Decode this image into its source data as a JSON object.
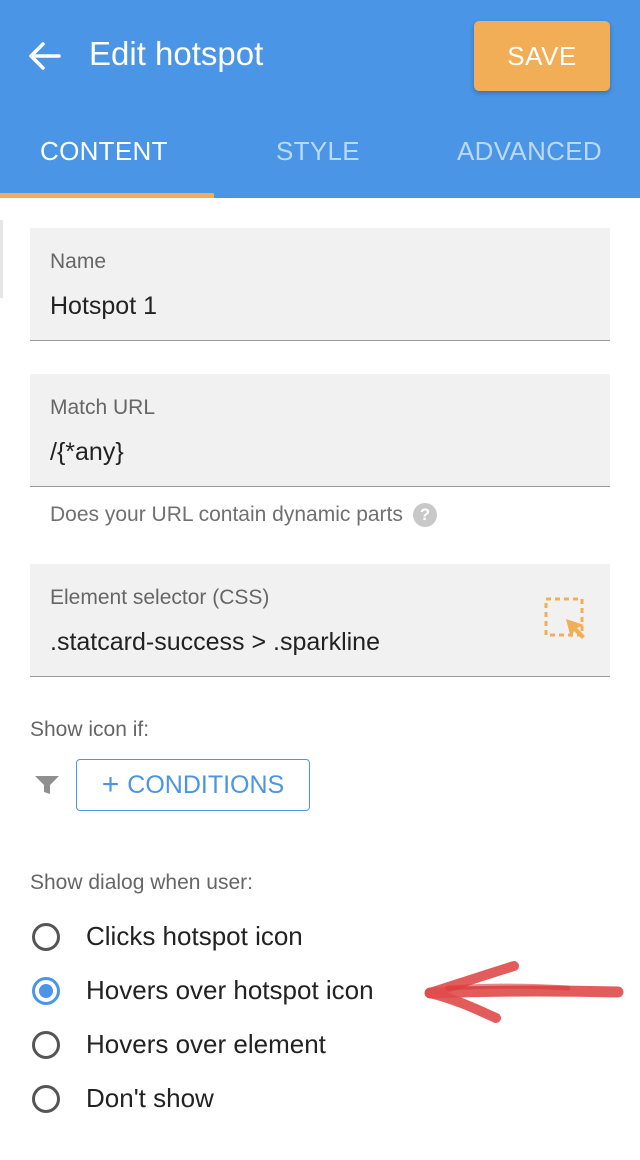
{
  "header": {
    "title": "Edit hotspot",
    "save_label": "SAVE",
    "tabs": [
      {
        "label": "CONTENT",
        "active": true
      },
      {
        "label": "STYLE",
        "active": false
      },
      {
        "label": "ADVANCED",
        "active": false
      }
    ],
    "accent_color": "#4a95e6",
    "save_color": "#f2ad57"
  },
  "fields": {
    "name": {
      "label": "Name",
      "value": "Hotspot 1"
    },
    "match_url": {
      "label": "Match URL",
      "value": "/{*any}",
      "hint": "Does your URL contain dynamic parts"
    },
    "selector": {
      "label": "Element selector (CSS)",
      "value": ".statcard-success > .sparkline"
    }
  },
  "conditions": {
    "label": "Show icon if:",
    "button_label": "CONDITIONS"
  },
  "dialog": {
    "label": "Show dialog when user:",
    "options": [
      {
        "label": "Clicks hotspot icon",
        "checked": false
      },
      {
        "label": "Hovers over hotspot icon",
        "checked": true
      },
      {
        "label": "Hovers over element",
        "checked": false
      },
      {
        "label": "Don't show",
        "checked": false
      }
    ]
  },
  "icons": {
    "back": "arrow-left-icon",
    "help": "question-circle-icon",
    "picker": "element-picker-icon",
    "filter": "filter-icon",
    "annotation": "red-arrow-annotation"
  }
}
